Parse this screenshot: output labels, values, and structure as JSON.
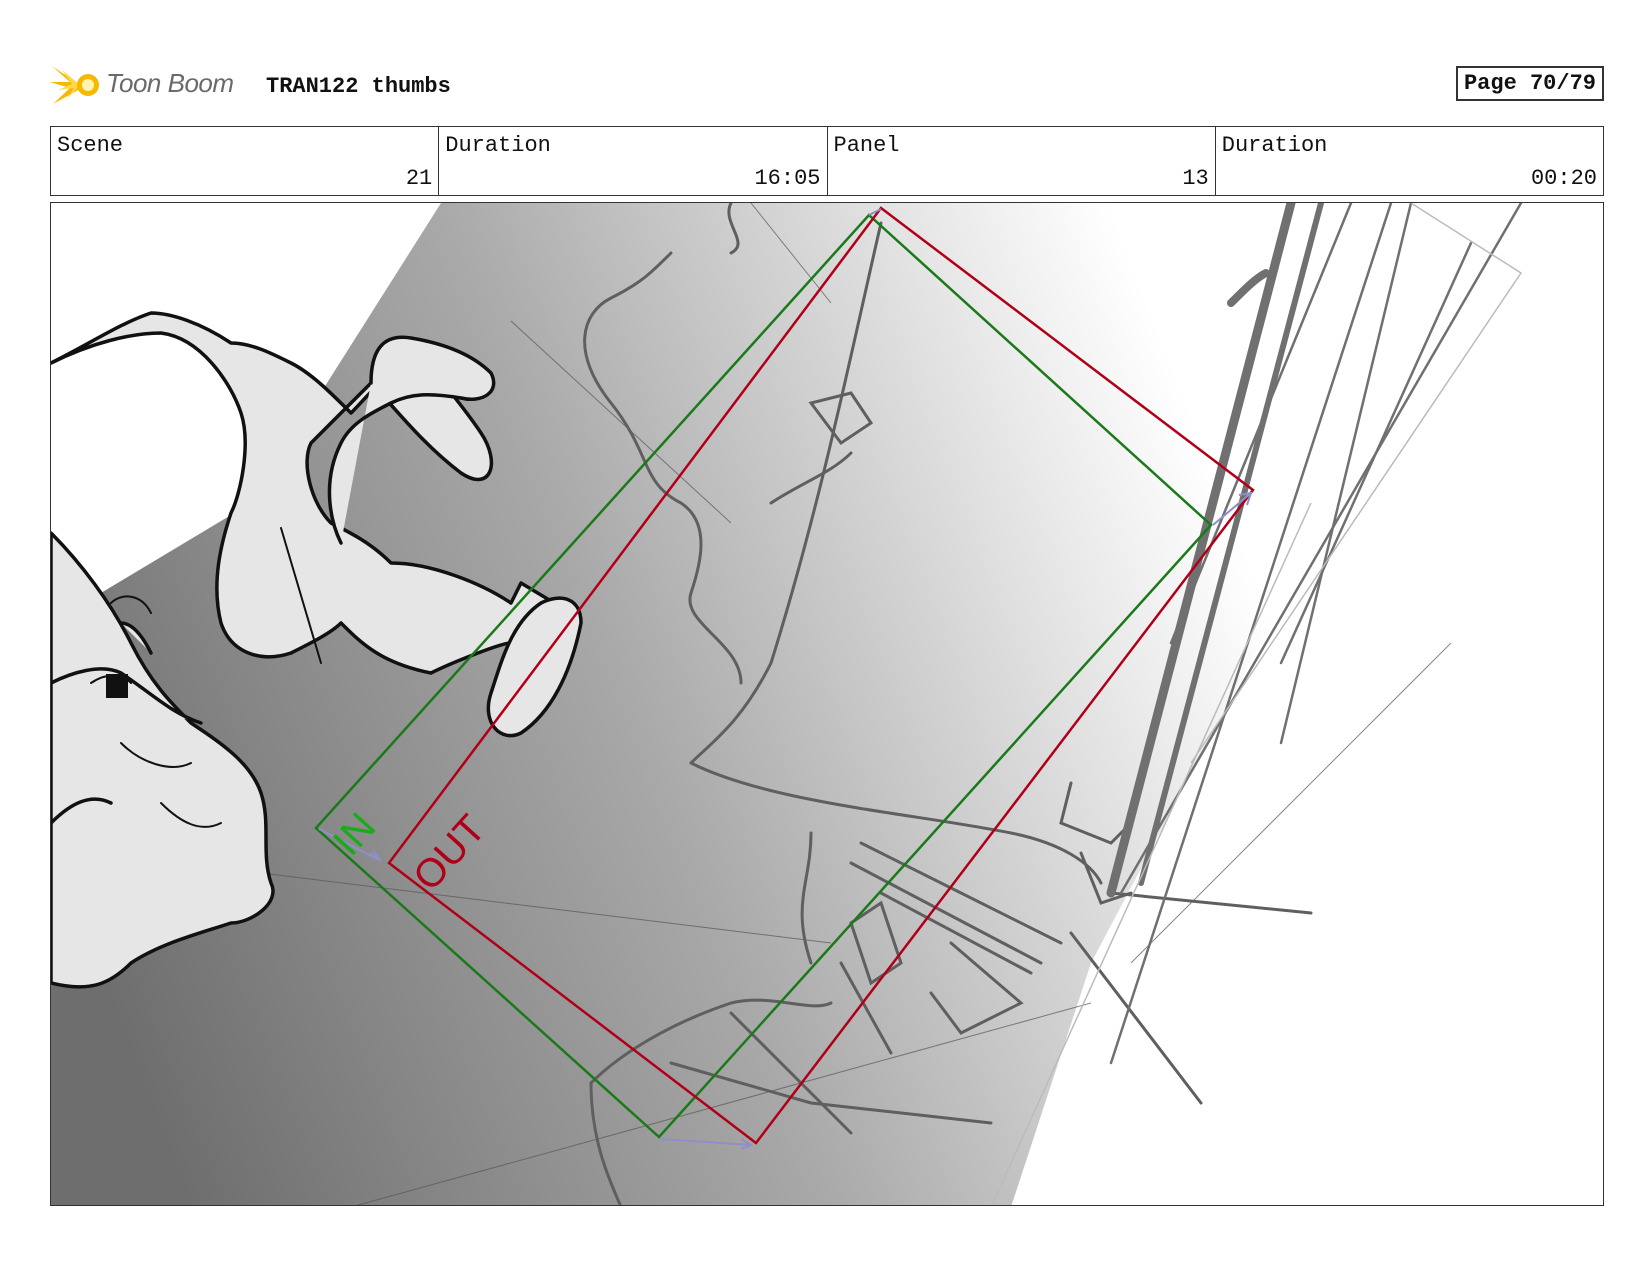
{
  "header": {
    "logo_text": "Toon Boom",
    "title": "TRAN122 thumbs",
    "page_label": "Page 70/79"
  },
  "info": {
    "scene_label": "Scene",
    "scene_value": "21",
    "scene_duration_label": "Duration",
    "scene_duration_value": "16:05",
    "panel_label": "Panel",
    "panel_value": "13",
    "panel_duration_label": "Duration",
    "panel_duration_value": "00:20"
  },
  "frame": {
    "in_label": "IN",
    "out_label": "OUT",
    "in_color": "#1a7a1a",
    "out_color": "#b00018"
  }
}
